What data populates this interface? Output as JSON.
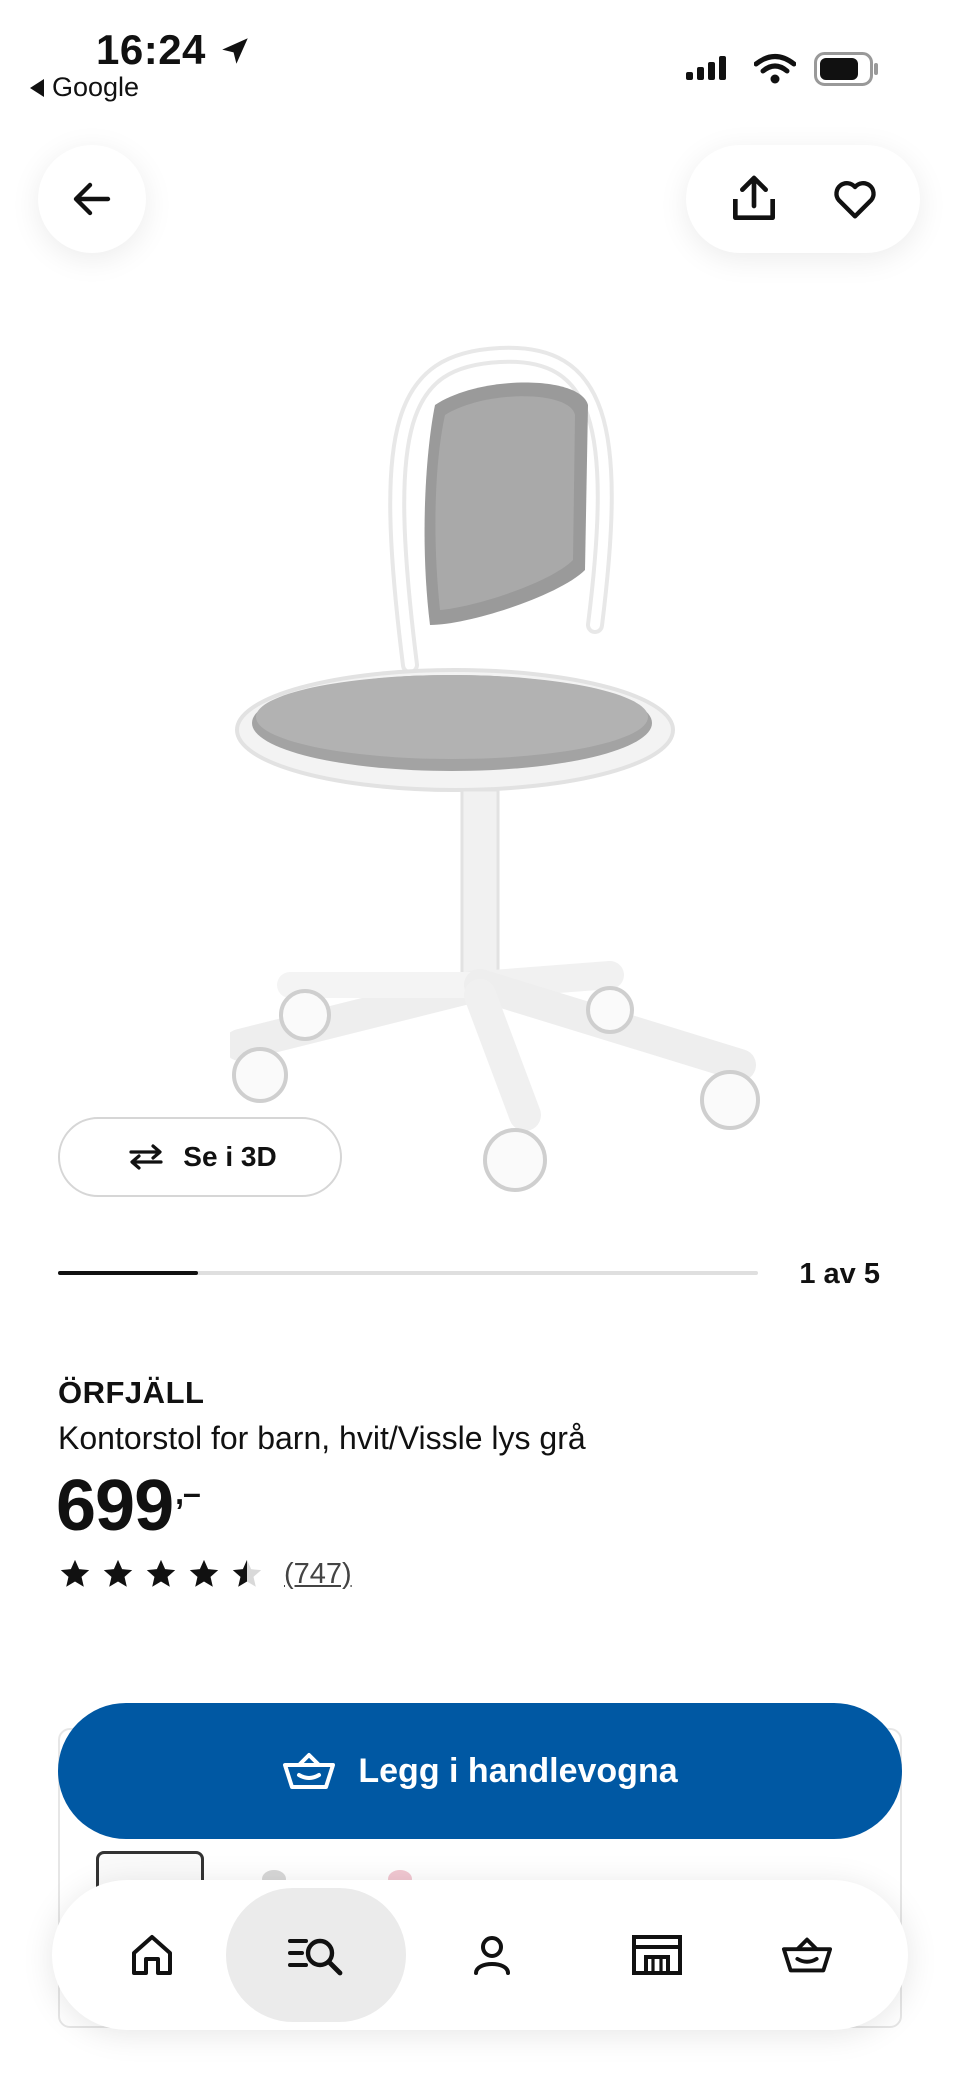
{
  "status_bar": {
    "time": "16:24",
    "back_app": "Google"
  },
  "top_bar": {
    "back_icon": "arrow-left-icon",
    "share_icon": "share-icon",
    "favorite_icon": "heart-icon"
  },
  "gallery": {
    "view_3d_label": "Se i 3D",
    "counter": "1 av 5",
    "progress": 0.2
  },
  "product": {
    "name": "ÖRFJÄLL",
    "description": "Kontorstol for barn, hvit/Vissle lys grå",
    "price": "699",
    "price_suffix": ",–",
    "rating": 4.5,
    "rating_count": "(747)"
  },
  "cart": {
    "button_label": "Legg i handlevogna"
  },
  "bottom_nav": {
    "items": [
      {
        "icon": "home-icon"
      },
      {
        "icon": "search-list-icon",
        "active": true
      },
      {
        "icon": "profile-icon"
      },
      {
        "icon": "store-icon"
      },
      {
        "icon": "basket-icon"
      }
    ]
  },
  "colors": {
    "brand_blue": "#0058a3",
    "text": "#111111"
  }
}
